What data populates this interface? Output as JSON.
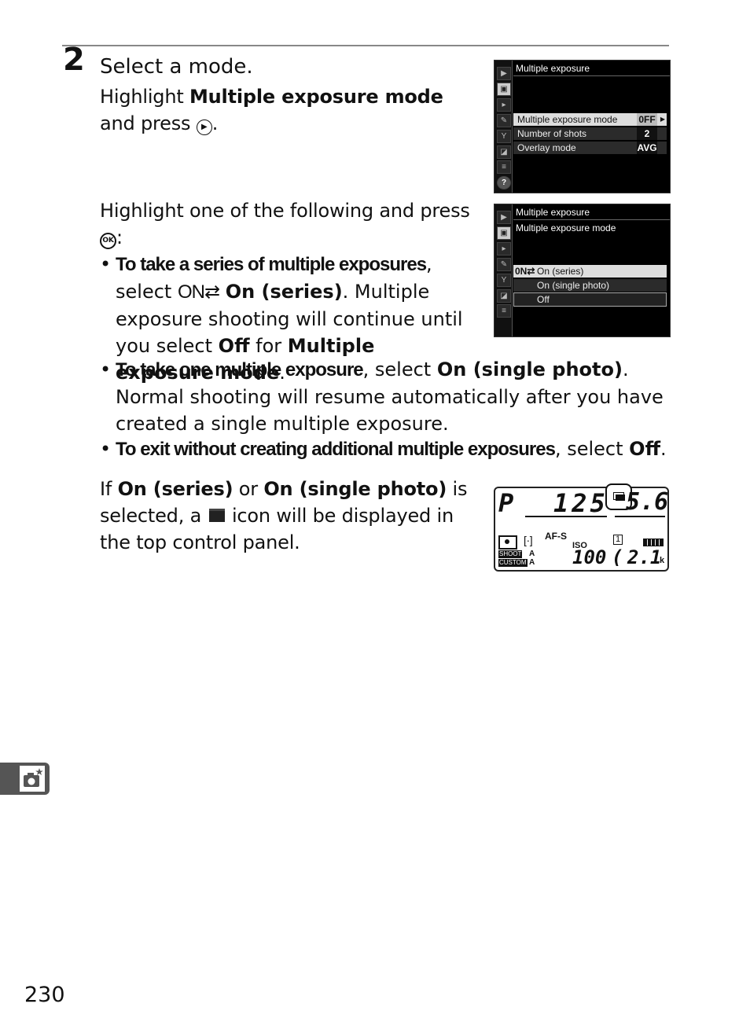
{
  "step": {
    "number": "2",
    "title": "Select a mode."
  },
  "intro": {
    "p1_pre": "Highlight ",
    "p1_bold": "Multiple exposure mode",
    "p1_post": " and press",
    "p1_icon": "multi-selector-right",
    "p1_end": ".",
    "p2": "Highlight one of the following and press",
    "p2_icon": "OK",
    "p2_end": ":"
  },
  "bullets": [
    {
      "lead": "To take a series of multiple exposures",
      "mid": ", select ",
      "icon": "ON⇄",
      "bold1": "On (series)",
      "text": ".  Multiple exposure shooting will continue until you select ",
      "bold2": "Off",
      "text2": " for ",
      "bold3": "Multiple exposure mode",
      "end": "."
    },
    {
      "lead": "To take one multiple exposure",
      "mid": ", select ",
      "bold1": "On (single photo)",
      "text": ".  Normal shooting will resume automatically after you have created a single multiple exposure."
    },
    {
      "lead": "To exit without creating additional multiple exposures",
      "mid": ", select ",
      "bold1": "Off",
      "end": "."
    }
  ],
  "note": {
    "pre": "If ",
    "bold1": "On (series)",
    "mid": " or ",
    "bold2": "On (single photo)",
    "post1": " is selected, a",
    "post2": "icon will be displayed in the top control panel."
  },
  "screen1": {
    "title": "Multiple exposure",
    "tabs": [
      "▶",
      "▣",
      "▸",
      "✎",
      "Y",
      "◪",
      "≡",
      "?"
    ],
    "rows": [
      {
        "label": "Multiple exposure mode",
        "value": "0FF",
        "selected": true
      },
      {
        "label": "Number of shots",
        "value": "2"
      },
      {
        "label": "Overlay mode",
        "value": "AVG"
      }
    ]
  },
  "screen2": {
    "title": "Multiple exposure",
    "subtitle": "Multiple exposure mode",
    "tabs": [
      "▶",
      "▣",
      "▸",
      "✎",
      "Y",
      "◪",
      "≡"
    ],
    "options": [
      {
        "icon": "0N⇄",
        "label": "On (series)",
        "selected": true
      },
      {
        "label": "On (single photo)"
      },
      {
        "label": "Off",
        "boxed": true
      }
    ]
  },
  "lcd": {
    "mode": "P",
    "shutter": "125",
    "aperture": "5.6",
    "af_mode": "AF-S",
    "iso_label": "ISO",
    "iso": "100",
    "release": "1",
    "shots_remaining": "2.1",
    "shots_unit": "k",
    "shoot_bank": "SHOOT",
    "shoot_value": "A",
    "custom_bank": "CUSTOM",
    "custom_value": "A"
  },
  "side_tab_icon": "photo-shooting-menu",
  "page_number": "230"
}
